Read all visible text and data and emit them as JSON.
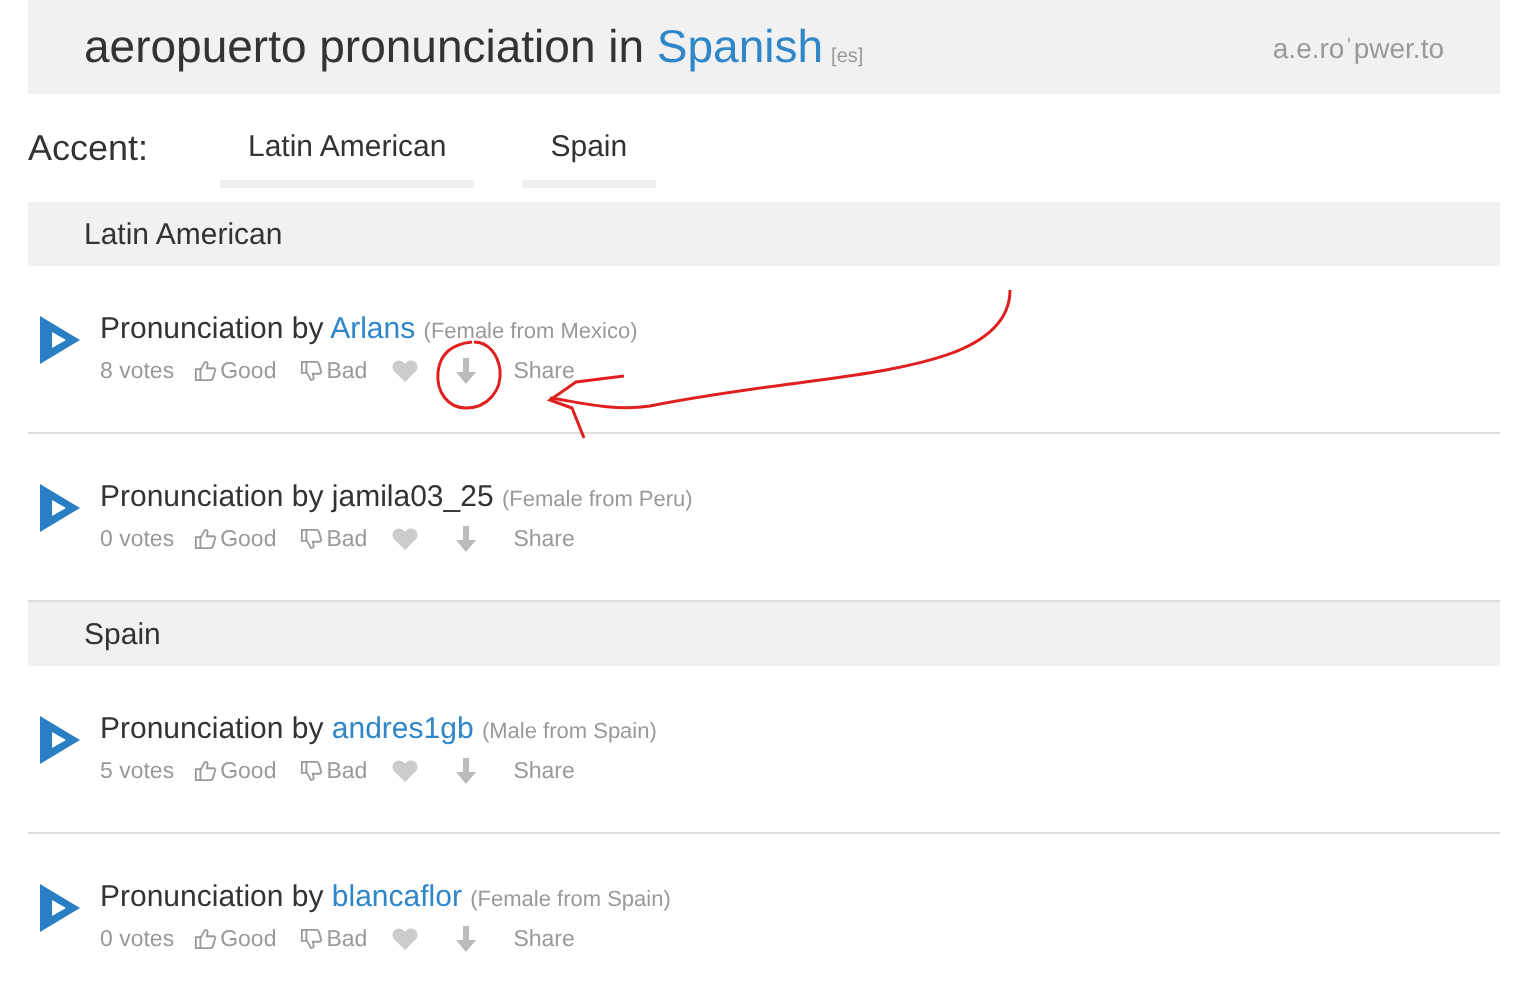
{
  "header": {
    "word": "aeropuerto",
    "middle": "pronunciation in",
    "language": "Spanish",
    "code": "[es]",
    "phonetic": "a.e.roˈpwer.to"
  },
  "accent": {
    "label": "Accent:",
    "tabs": [
      {
        "label": "Latin American"
      },
      {
        "label": "Spain"
      }
    ]
  },
  "sections": [
    {
      "title": "Latin American",
      "rows": [
        {
          "prefix": "Pronunciation by",
          "author": "Arlans",
          "linked": true,
          "origin": "(Female from Mexico)",
          "votes": "8 votes",
          "good": "Good",
          "bad": "Bad",
          "share": "Share"
        },
        {
          "prefix": "Pronunciation by",
          "author": "jamila03_25",
          "linked": false,
          "origin": "(Female from Peru)",
          "votes": "0 votes",
          "good": "Good",
          "bad": "Bad",
          "share": "Share"
        }
      ]
    },
    {
      "title": "Spain",
      "rows": [
        {
          "prefix": "Pronunciation by",
          "author": "andres1gb",
          "linked": true,
          "origin": "(Male from Spain)",
          "votes": "5 votes",
          "good": "Good",
          "bad": "Bad",
          "share": "Share"
        },
        {
          "prefix": "Pronunciation by",
          "author": "blancaflor",
          "linked": true,
          "origin": "(Female from Spain)",
          "votes": "0 votes",
          "good": "Good",
          "bad": "Bad",
          "share": "Share"
        }
      ]
    }
  ],
  "annotation": {
    "kind": "circle-and-arrow"
  }
}
